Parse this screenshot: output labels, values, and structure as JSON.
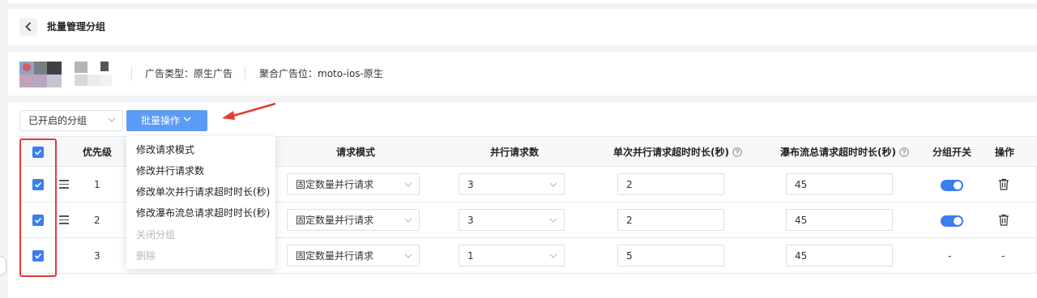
{
  "header": {
    "title": "批量管理分组"
  },
  "info": {
    "ad_type_label": "广告类型：原生广告",
    "placement_label": "聚合广告位：moto-ios-原生"
  },
  "toolbar": {
    "group_filter": "已开启的分组",
    "batch_button": "批量操作"
  },
  "table": {
    "headers": {
      "priority": "优先级",
      "request_mode": "请求模式",
      "parallel_count": "并行请求数",
      "single_timeout": "单次并行请求超时时长(秒)",
      "waterfall_timeout": "瀑布流总请求超时时长(秒)",
      "group_switch": "分组开关",
      "actions": "操作"
    },
    "rows": [
      {
        "priority": "1",
        "mode": "固定数量并行请求",
        "parallel": "3",
        "single_timeout": "2",
        "total_timeout": "45",
        "switch": "on",
        "action": "delete"
      },
      {
        "priority": "2",
        "mode": "固定数量并行请求",
        "parallel": "3",
        "single_timeout": "2",
        "total_timeout": "45",
        "switch": "on",
        "action": "delete"
      },
      {
        "priority": "3",
        "mode": "固定数量并行请求",
        "parallel": "1",
        "single_timeout": "5",
        "total_timeout": "45",
        "switch_text": "-",
        "action_text": "-"
      }
    ]
  },
  "dropdown": {
    "items": [
      {
        "label": "修改请求模式",
        "disabled": false
      },
      {
        "label": "修改并行请求数",
        "disabled": false
      },
      {
        "label": "修改单次并行请求超时时长(秒)",
        "disabled": false
      },
      {
        "label": "修改瀑布流总请求超时时长(秒)",
        "disabled": false
      },
      {
        "label": "关闭分组",
        "disabled": true
      },
      {
        "label": "删除",
        "disabled": true
      }
    ]
  },
  "colors": {
    "primary": "#3a7ef0",
    "batch_button": "#5b9bf5",
    "annotation_red": "#e53935",
    "disabled_text": "#b5b8bd"
  },
  "icons": [
    "back-arrow-icon",
    "chevron-down-icon",
    "help-circle-icon",
    "drag-handle-icon",
    "trash-icon",
    "check-icon",
    "annotation-arrow-icon"
  ]
}
